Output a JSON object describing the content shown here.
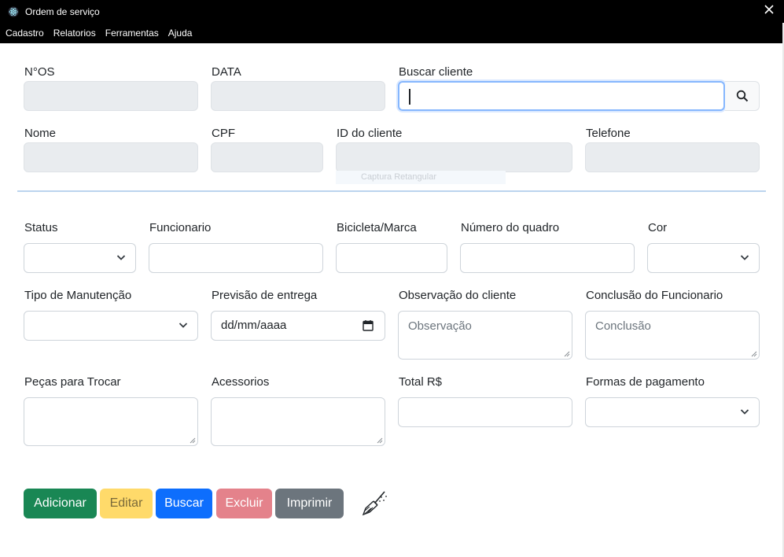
{
  "window": {
    "title": "Ordem de serviço",
    "icon": "electron-atom-icon",
    "close_icon": "close-icon"
  },
  "menu": [
    "Cadastro",
    "Relatorios",
    "Ferramentas",
    "Ajuda"
  ],
  "client_section": {
    "os_number": {
      "label": "N°OS",
      "value": ""
    },
    "date": {
      "label": "DATA",
      "value": ""
    },
    "search_client": {
      "label": "Buscar cliente",
      "value": "",
      "button_icon": "search-icon"
    },
    "name": {
      "label": "Nome",
      "value": ""
    },
    "cpf": {
      "label": "CPF",
      "value": ""
    },
    "client_id": {
      "label": "ID do cliente",
      "value": ""
    },
    "phone": {
      "label": "Telefone",
      "value": ""
    }
  },
  "overlay_tooltip": "Captura Retangular",
  "service_section": {
    "status": {
      "label": "Status",
      "value": ""
    },
    "employee": {
      "label": "Funcionario",
      "value": ""
    },
    "bike_brand": {
      "label": "Bicicleta/Marca",
      "value": ""
    },
    "frame_number": {
      "label": "Número do quadro",
      "value": ""
    },
    "color": {
      "label": "Cor",
      "value": ""
    },
    "maintenance_type": {
      "label": "Tipo de Manutenção",
      "value": ""
    },
    "delivery_date": {
      "label": "Previsão de entrega",
      "placeholder": "dd/mm/aaaa"
    },
    "client_note": {
      "label": "Observação do cliente",
      "placeholder": "Observação"
    },
    "employee_conclusion": {
      "label": "Conclusão do Funcionario",
      "placeholder": "Conclusão"
    },
    "parts": {
      "label": "Peças para Trocar",
      "value": ""
    },
    "accessories": {
      "label": "Acessorios",
      "value": ""
    },
    "total": {
      "label": "Total R$",
      "value": ""
    },
    "payment": {
      "label": "Formas de pagamento",
      "value": ""
    }
  },
  "actions": {
    "add": "Adicionar",
    "edit": "Editar",
    "search": "Buscar",
    "delete": "Excluir",
    "print": "Imprimir",
    "clear_icon": "broom-icon"
  },
  "colors": {
    "add": "#198754",
    "edit": "#ffda6a",
    "search": "#0d6efd",
    "delete": "#e685b5",
    "print": "#6c757d",
    "focus_border": "#86b7fe"
  }
}
